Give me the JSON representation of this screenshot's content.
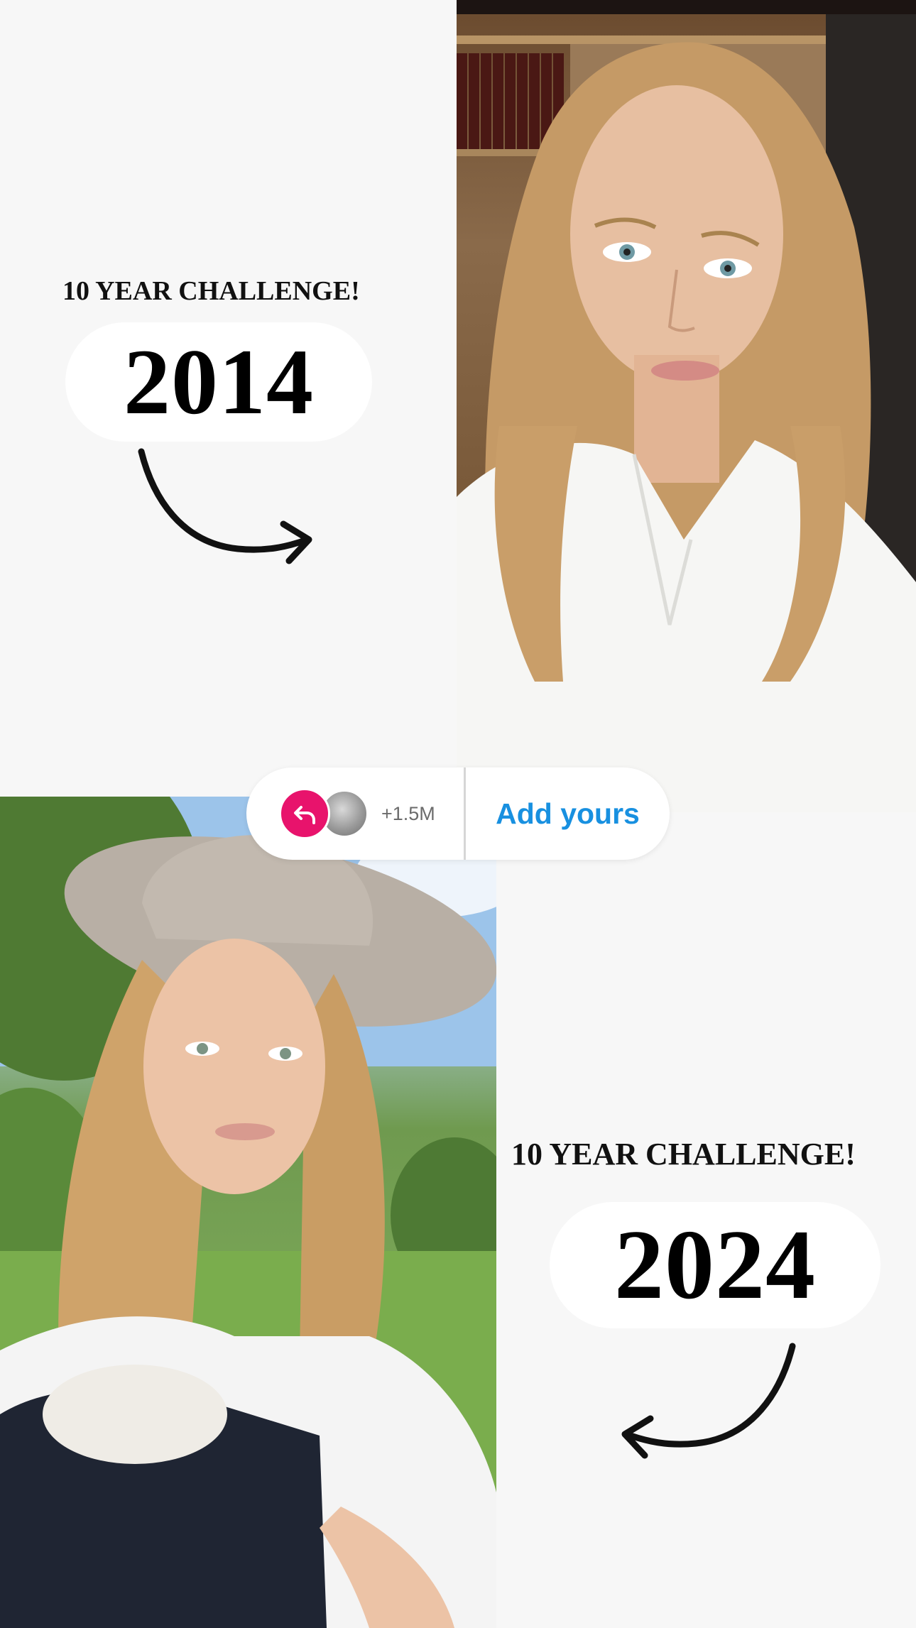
{
  "story": {
    "top_panel": {
      "title": "10 YEAR CHALLENGE!",
      "year": "2014"
    },
    "bottom_panel": {
      "title": "10 YEAR CHALLENGE!",
      "year": "2024"
    }
  },
  "sticker": {
    "participant_count": "+1.5M",
    "add_yours_label": "Add yours",
    "accent_color": "#e8136c",
    "link_color": "#1890e0"
  },
  "icons": {
    "reply": "reply-arrow-icon",
    "arrow_top": "curved-arrow-right-icon",
    "arrow_bottom": "curved-arrow-left-icon"
  }
}
